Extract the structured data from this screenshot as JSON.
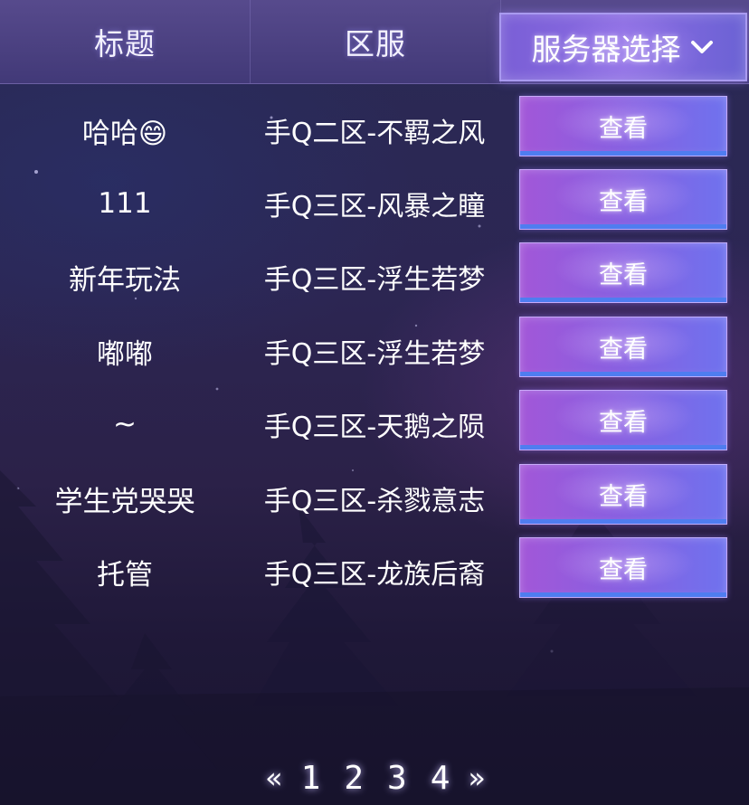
{
  "header": {
    "title_label": "标题",
    "zone_label": "区服",
    "server_select_label": "服务器选择",
    "server_select_icon": "chevron-down-icon"
  },
  "rows": [
    {
      "title": "哈哈😄",
      "zone": "手Q二区-不羁之风",
      "button": "查看"
    },
    {
      "title": "111",
      "zone": "手Q三区-风暴之瞳",
      "button": "查看"
    },
    {
      "title": "新年玩法",
      "zone": "手Q三区-浮生若梦",
      "button": "查看"
    },
    {
      "title": "嘟嘟",
      "zone": "手Q三区-浮生若梦",
      "button": "查看"
    },
    {
      "title": "~",
      "zone": "手Q三区-天鹅之陨",
      "button": "查看"
    },
    {
      "title": "学生党哭哭",
      "zone": "手Q三区-杀戮意志",
      "button": "查看"
    },
    {
      "title": "托管",
      "zone": "手Q三区-龙族后裔",
      "button": "查看"
    }
  ],
  "pagination": {
    "prev": "«",
    "next": "»",
    "pages": [
      "1",
      "2",
      "3",
      "4"
    ]
  },
  "colors": {
    "accent": "#8a6be2",
    "button_gradient_start": "#a257d8",
    "button_gradient_end": "#6f72ee",
    "button_bottom_edge": "#4f7df0"
  }
}
